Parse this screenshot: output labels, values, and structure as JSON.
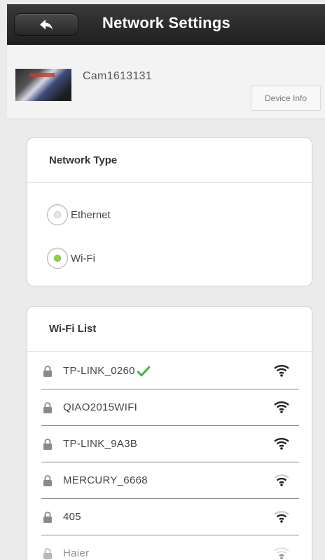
{
  "header": {
    "title": "Network Settings",
    "back_icon": "back-arrow-icon"
  },
  "device": {
    "name": "Cam1613131",
    "info_button": "Device Info"
  },
  "network_type": {
    "title": "Network Type",
    "options": [
      {
        "label": "Ethernet",
        "selected": false
      },
      {
        "label": "Wi-Fi",
        "selected": true
      }
    ]
  },
  "wifi_list": {
    "title": "Wi-Fi List",
    "networks": [
      {
        "ssid": "TP-LINK_0260",
        "connected": true,
        "locked": true,
        "signal": "strong"
      },
      {
        "ssid": "QIAO2015WIFI",
        "connected": false,
        "locked": true,
        "signal": "strong"
      },
      {
        "ssid": "TP-LINK_9A3B",
        "connected": false,
        "locked": true,
        "signal": "strong"
      },
      {
        "ssid": "MERCURY_6668",
        "connected": false,
        "locked": true,
        "signal": "medium"
      },
      {
        "ssid": "405",
        "connected": false,
        "locked": true,
        "signal": "medium"
      },
      {
        "ssid": "Haier",
        "connected": false,
        "locked": true,
        "signal": "weak"
      }
    ]
  },
  "colors": {
    "header": "#262626",
    "selected_radio": "#8bd63a",
    "connected_check": "#3db83a"
  }
}
